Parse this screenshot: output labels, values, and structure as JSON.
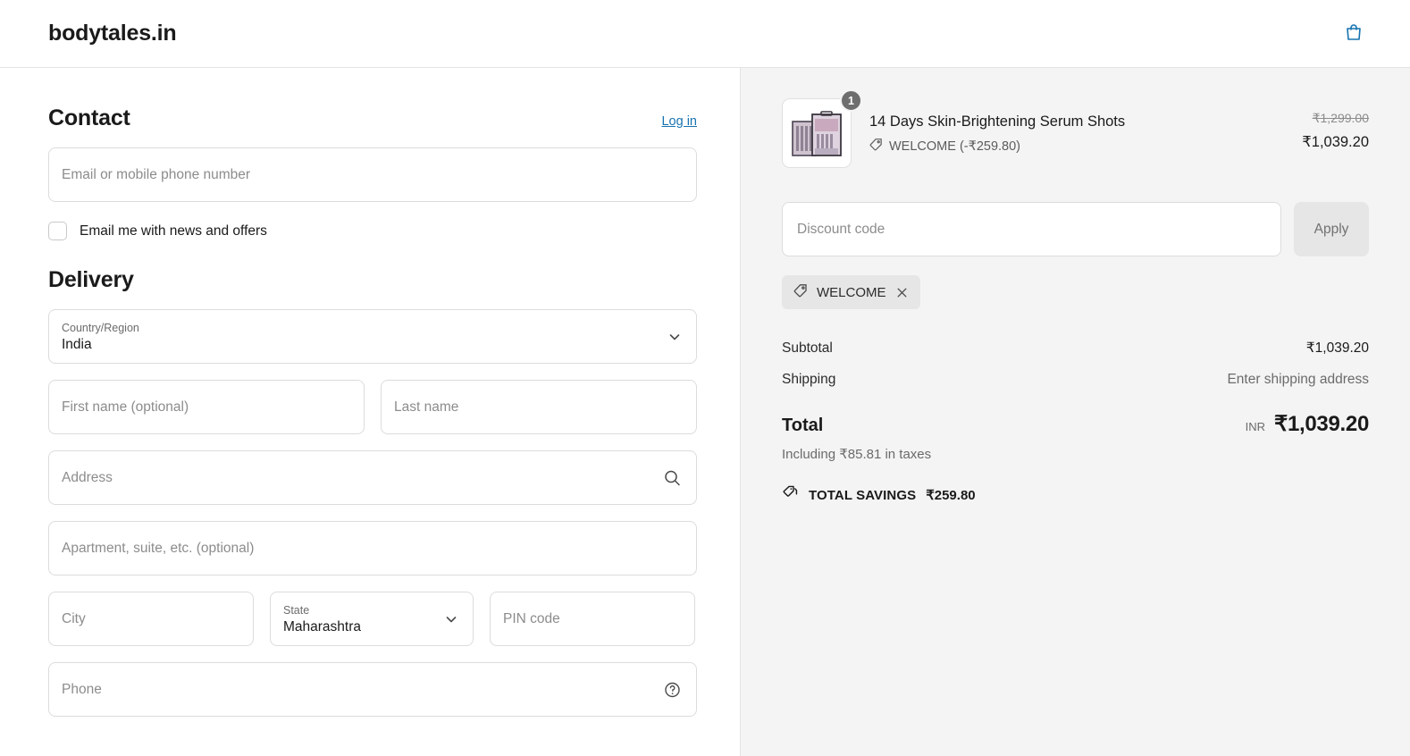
{
  "header": {
    "shop_name": "bodytales.in",
    "cart_icon": "shopping-bag-icon",
    "cart_icon_color": "#1773b0"
  },
  "contact": {
    "title": "Contact",
    "login_label": "Log in",
    "email_placeholder": "Email or mobile phone number",
    "email_value": "",
    "newsletter_label": "Email me with news and offers",
    "newsletter_checked": false
  },
  "delivery": {
    "title": "Delivery",
    "country": {
      "label": "Country/Region",
      "value": "India",
      "icon": "chevron-down-icon"
    },
    "first_name_placeholder": "First name (optional)",
    "first_name_value": "",
    "last_name_placeholder": "Last name",
    "last_name_value": "",
    "address_placeholder": "Address",
    "address_value": "",
    "address_icon": "search-icon",
    "apartment_placeholder": "Apartment, suite, etc. (optional)",
    "apartment_value": "",
    "city_placeholder": "City",
    "city_value": "",
    "state": {
      "label": "State",
      "value": "Maharashtra",
      "icon": "chevron-down-icon"
    },
    "pin_placeholder": "PIN code",
    "pin_value": "",
    "phone_placeholder": "Phone",
    "phone_value": "",
    "phone_icon": "help-circle-icon"
  },
  "order_summary": {
    "item": {
      "quantity": "1",
      "title": "14 Days Skin-Brightening Serum Shots",
      "discount_tag_icon": "tag-icon",
      "discount_text": "WELCOME (-₹259.80)",
      "original_price": "₹1,299.00",
      "price": "₹1,039.20"
    },
    "discount": {
      "placeholder": "Discount code",
      "value": "",
      "apply_label": "Apply",
      "chip_label": "WELCOME",
      "chip_tag_icon": "tag-icon",
      "chip_close_icon": "close-icon"
    },
    "subtotal_label": "Subtotal",
    "subtotal_value": "₹1,039.20",
    "shipping_label": "Shipping",
    "shipping_value": "Enter shipping address",
    "total_label": "Total",
    "total_currency": "INR",
    "total_value": "₹1,039.20",
    "taxes_note": "Including ₹85.81 in taxes",
    "savings_icon": "tags-icon",
    "savings_label": "TOTAL SAVINGS",
    "savings_value": "₹259.80"
  }
}
